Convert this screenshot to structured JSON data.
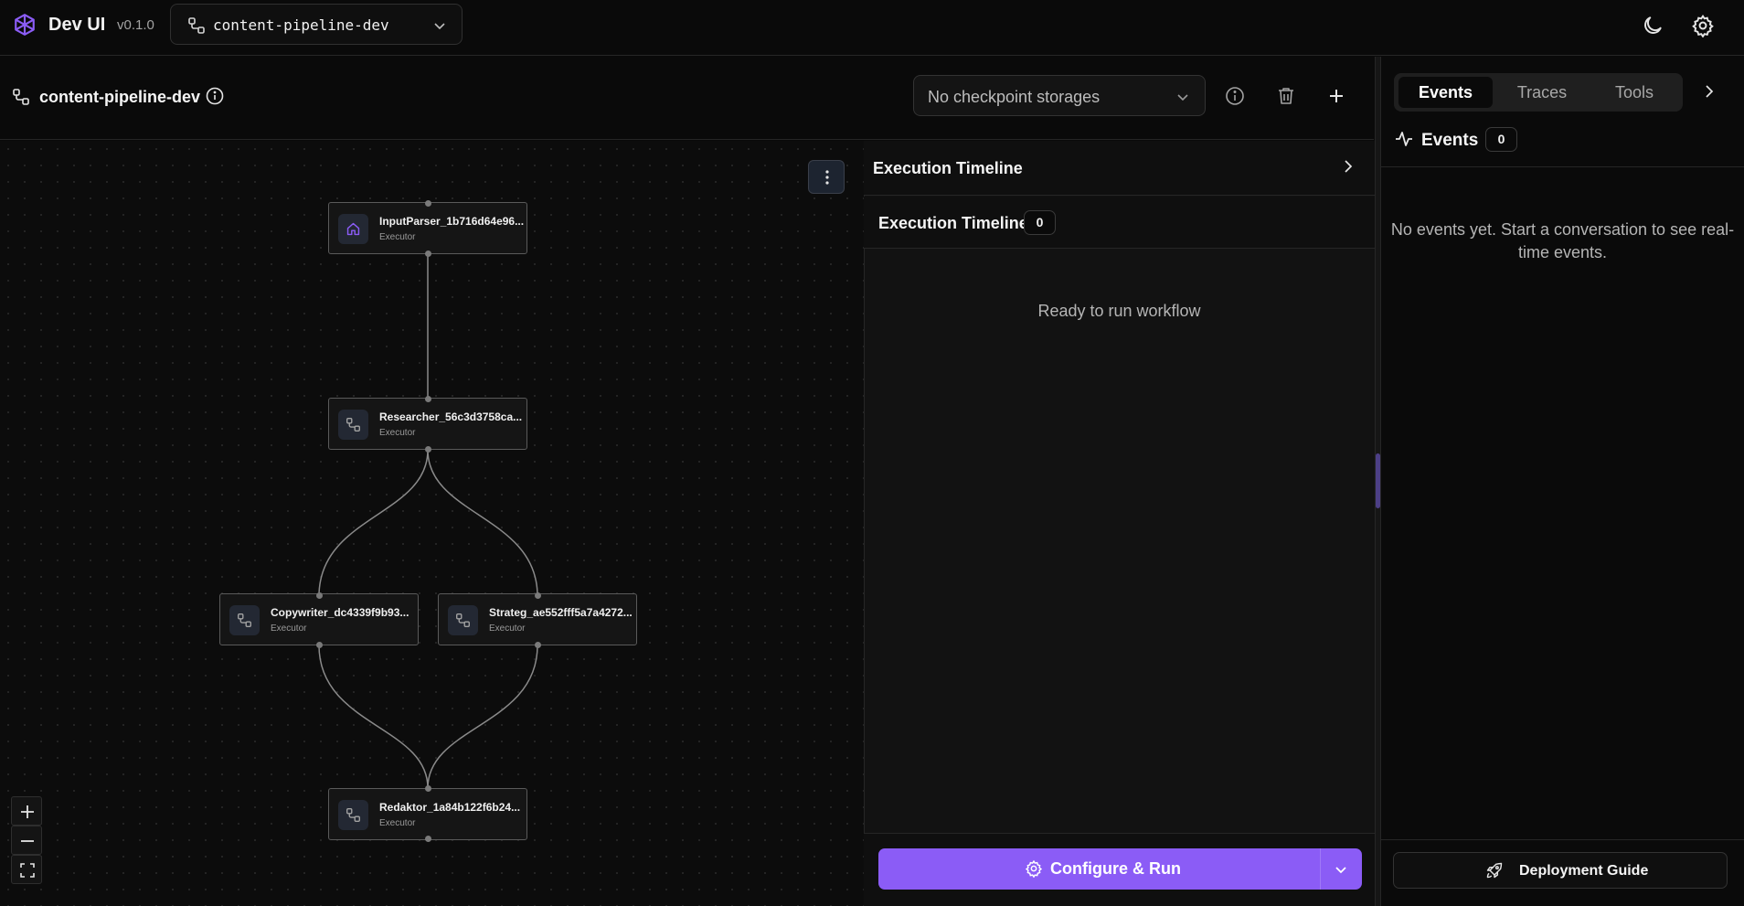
{
  "app": {
    "name": "Dev UI",
    "version": "v0.1.0",
    "accent": "#8b5cf6"
  },
  "entity_selector": {
    "value": "content-pipeline-dev"
  },
  "workflow": {
    "title": "content-pipeline-dev",
    "checkpoint_storage": "No checkpoint storages"
  },
  "graph": {
    "nodes": [
      {
        "name": "InputParser_1b716d64e96...",
        "type": "Executor",
        "icon": "home-icon"
      },
      {
        "name": "Researcher_56c3d3758ca...",
        "type": "Executor",
        "icon": "workflow-icon"
      },
      {
        "name": "Copywriter_dc4339f9b93...",
        "type": "Executor",
        "icon": "workflow-icon"
      },
      {
        "name": "Strateg_ae552fff5a7a4272...",
        "type": "Executor",
        "icon": "workflow-icon"
      },
      {
        "name": "Redaktor_1a84b122f6b24...",
        "type": "Executor",
        "icon": "workflow-icon"
      }
    ],
    "zoom_controls": [
      "zoom-in",
      "zoom-out",
      "fit-view"
    ]
  },
  "timeline": {
    "header_title": "Execution Timeline",
    "sub_title": "Execution Timeline",
    "count": "0",
    "empty_text": "Ready to run workflow",
    "run_label": "Configure & Run"
  },
  "right_panel": {
    "tabs": [
      "Events",
      "Traces",
      "Tools"
    ],
    "active_tab": "Events",
    "events_title": "Events",
    "events_count": "0",
    "empty_text": "No events yet. Start a conversation to see real-time events.",
    "deploy_label": "Deployment Guide"
  }
}
